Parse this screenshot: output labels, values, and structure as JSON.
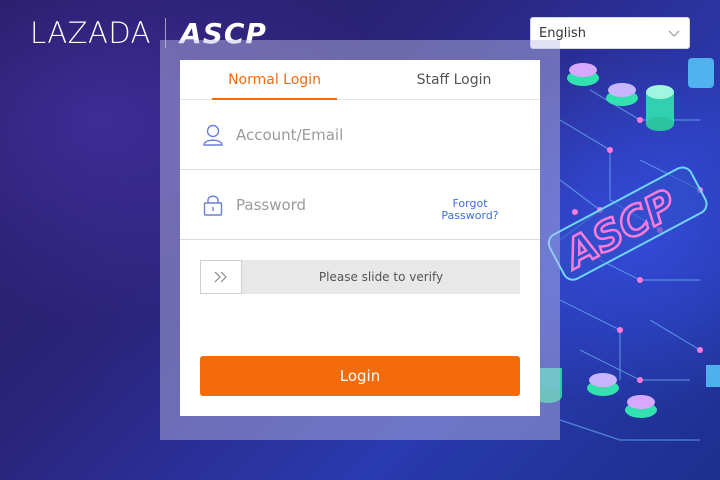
{
  "brand": {
    "primary": "LAZADA",
    "secondary": "ASCP"
  },
  "language": {
    "selected": "English",
    "icon": "chevron-down-icon"
  },
  "tabs": [
    {
      "label": "Normal Login",
      "active": true
    },
    {
      "label": "Staff Login",
      "active": false
    }
  ],
  "form": {
    "account": {
      "placeholder": "Account/Email",
      "value": "",
      "icon": "user-icon"
    },
    "password": {
      "placeholder": "Password",
      "value": "",
      "icon": "lock-icon"
    },
    "forgot": "Forgot Password?",
    "slider": {
      "text": "Please slide to verify",
      "icon": "double-chevron-right-icon"
    },
    "submit": "Login"
  },
  "colors": {
    "accent": "#f46b0c",
    "link": "#3d6fd6",
    "background": "#231a5e"
  }
}
